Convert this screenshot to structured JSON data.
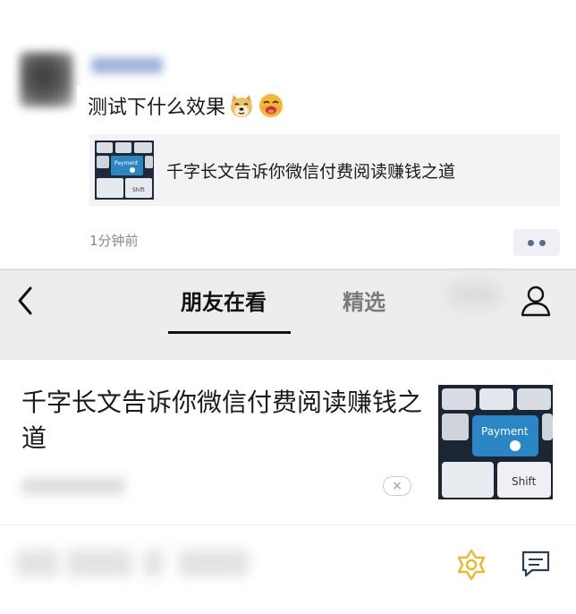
{
  "post": {
    "text": "测试下什么效果",
    "emojis": [
      "doge-icon",
      "laughing-face-icon"
    ],
    "link": {
      "title": "千字长文告诉你微信付费阅读赚钱之道",
      "thumbnail": "payment-keyboard-image"
    },
    "time": "1分钟前"
  },
  "top_stories": {
    "tabs": [
      {
        "label": "朋友在看",
        "active": true
      },
      {
        "label": "精选",
        "active": false
      }
    ],
    "article": {
      "title": "千字长文告诉你微信付费阅读赚钱之道",
      "thumbnail": "payment-keyboard-image",
      "dismiss": "×"
    }
  },
  "thumb_text": {
    "payment": "Payment",
    "shift": "Shift"
  },
  "colors": {
    "link_card_bg": "#f3f3f5",
    "nav_bg": "#ededed",
    "accent_gold": "#e9b92a",
    "more_dots": "#5a6b8f"
  }
}
